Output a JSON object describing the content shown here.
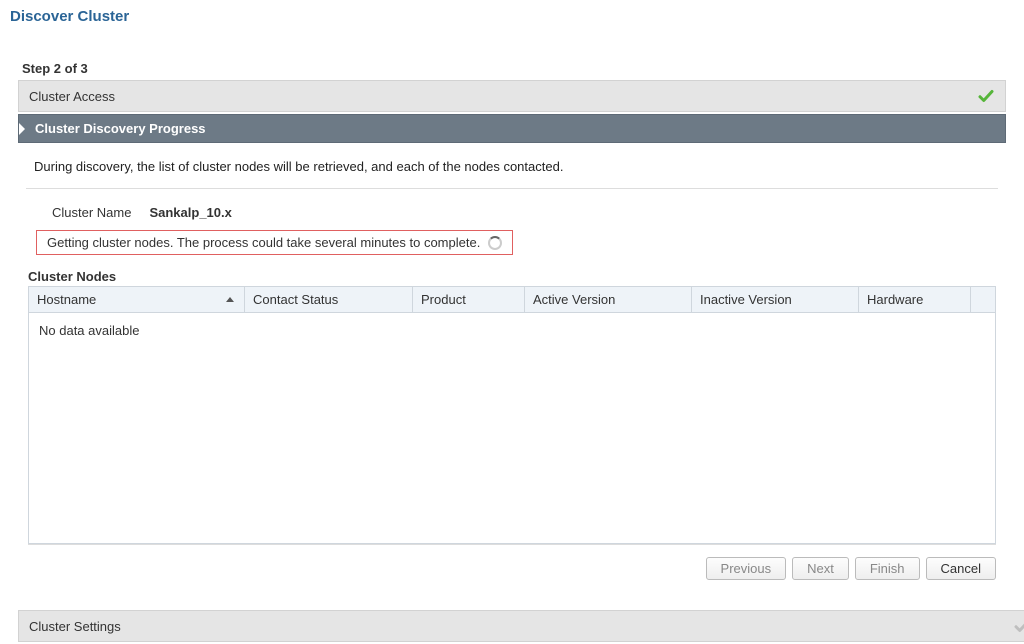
{
  "page_title": "Discover Cluster",
  "step_label": "Step 2 of 3",
  "bands": {
    "cluster_access": "Cluster Access",
    "cluster_discovery_progress": "Cluster Discovery Progress",
    "cluster_settings": "Cluster Settings"
  },
  "body": {
    "description": "During discovery, the list of cluster nodes will be retrieved, and each of the nodes contacted.",
    "cluster_name_label": "Cluster Name",
    "cluster_name_value": "Sankalp_10.x",
    "status_message": "Getting cluster nodes. The process could take several minutes to complete."
  },
  "table": {
    "title": "Cluster Nodes",
    "columns": {
      "hostname": "Hostname",
      "contact_status": "Contact Status",
      "product": "Product",
      "active_version": "Active Version",
      "inactive_version": "Inactive Version",
      "hardware": "Hardware"
    },
    "rows": [],
    "empty_text": "No data available"
  },
  "buttons": {
    "previous": "Previous",
    "next": "Next",
    "finish": "Finish",
    "cancel": "Cancel"
  }
}
